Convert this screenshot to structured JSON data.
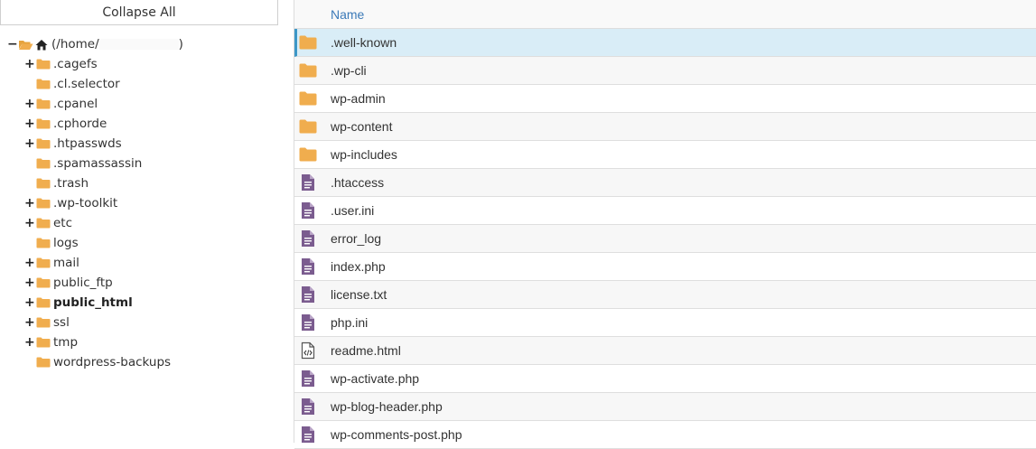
{
  "tree": {
    "collapse_label": "Collapse All",
    "root": {
      "label": "(/home/",
      "close": ")",
      "toggle": "−"
    },
    "items": [
      {
        "label": ".cagefs",
        "toggle": "+",
        "bold": false
      },
      {
        "label": ".cl.selector",
        "toggle": "",
        "bold": false
      },
      {
        "label": ".cpanel",
        "toggle": "+",
        "bold": false
      },
      {
        "label": ".cphorde",
        "toggle": "+",
        "bold": false
      },
      {
        "label": ".htpasswds",
        "toggle": "+",
        "bold": false
      },
      {
        "label": ".spamassassin",
        "toggle": "",
        "bold": false
      },
      {
        "label": ".trash",
        "toggle": "",
        "bold": false
      },
      {
        "label": ".wp-toolkit",
        "toggle": "+",
        "bold": false
      },
      {
        "label": "etc",
        "toggle": "+",
        "bold": false
      },
      {
        "label": "logs",
        "toggle": "",
        "bold": false
      },
      {
        "label": "mail",
        "toggle": "+",
        "bold": false
      },
      {
        "label": "public_ftp",
        "toggle": "+",
        "bold": false
      },
      {
        "label": "public_html",
        "toggle": "+",
        "bold": true
      },
      {
        "label": "ssl",
        "toggle": "+",
        "bold": false
      },
      {
        "label": "tmp",
        "toggle": "+",
        "bold": false
      },
      {
        "label": "wordpress-backups",
        "toggle": "",
        "bold": false
      }
    ]
  },
  "list": {
    "header_name": "Name",
    "files": [
      {
        "name": ".well-known",
        "icon": "folder-icon",
        "selected": true
      },
      {
        "name": ".wp-cli",
        "icon": "folder-icon"
      },
      {
        "name": "wp-admin",
        "icon": "folder-icon"
      },
      {
        "name": "wp-content",
        "icon": "folder-icon"
      },
      {
        "name": "wp-includes",
        "icon": "folder-icon"
      },
      {
        "name": ".htaccess",
        "icon": "text-file-icon"
      },
      {
        "name": ".user.ini",
        "icon": "text-file-icon"
      },
      {
        "name": "error_log",
        "icon": "text-file-icon"
      },
      {
        "name": "index.php",
        "icon": "text-file-icon"
      },
      {
        "name": "license.txt",
        "icon": "text-file-icon"
      },
      {
        "name": "php.ini",
        "icon": "text-file-icon"
      },
      {
        "name": "readme.html",
        "icon": "code-file-icon"
      },
      {
        "name": "wp-activate.php",
        "icon": "text-file-icon"
      },
      {
        "name": "wp-blog-header.php",
        "icon": "text-file-icon"
      },
      {
        "name": "wp-comments-post.php",
        "icon": "text-file-icon"
      }
    ]
  },
  "colors": {
    "folder": "#f0ad4e",
    "file": "#7b5c8f",
    "header_text": "#3c7ab8",
    "selected_bg": "#d9edf7",
    "selected_border": "#3c97c7"
  }
}
